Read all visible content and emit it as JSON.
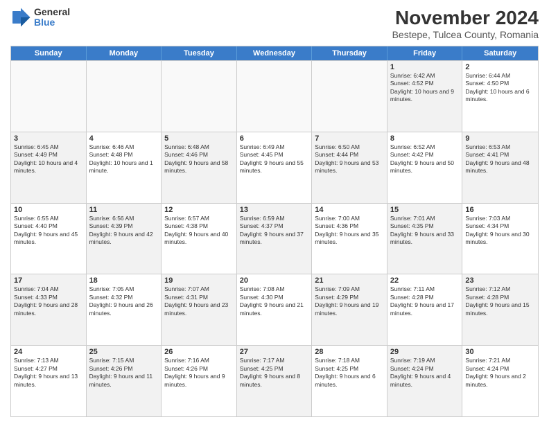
{
  "logo": {
    "general": "General",
    "blue": "Blue"
  },
  "title": "November 2024",
  "location": "Bestepe, Tulcea County, Romania",
  "headers": [
    "Sunday",
    "Monday",
    "Tuesday",
    "Wednesday",
    "Thursday",
    "Friday",
    "Saturday"
  ],
  "rows": [
    [
      {
        "day": "",
        "info": ""
      },
      {
        "day": "",
        "info": ""
      },
      {
        "day": "",
        "info": ""
      },
      {
        "day": "",
        "info": ""
      },
      {
        "day": "",
        "info": ""
      },
      {
        "day": "1",
        "info": "Sunrise: 6:42 AM\nSunset: 4:52 PM\nDaylight: 10 hours and 9 minutes."
      },
      {
        "day": "2",
        "info": "Sunrise: 6:44 AM\nSunset: 4:50 PM\nDaylight: 10 hours and 6 minutes."
      }
    ],
    [
      {
        "day": "3",
        "info": "Sunrise: 6:45 AM\nSunset: 4:49 PM\nDaylight: 10 hours and 4 minutes."
      },
      {
        "day": "4",
        "info": "Sunrise: 6:46 AM\nSunset: 4:48 PM\nDaylight: 10 hours and 1 minute."
      },
      {
        "day": "5",
        "info": "Sunrise: 6:48 AM\nSunset: 4:46 PM\nDaylight: 9 hours and 58 minutes."
      },
      {
        "day": "6",
        "info": "Sunrise: 6:49 AM\nSunset: 4:45 PM\nDaylight: 9 hours and 55 minutes."
      },
      {
        "day": "7",
        "info": "Sunrise: 6:50 AM\nSunset: 4:44 PM\nDaylight: 9 hours and 53 minutes."
      },
      {
        "day": "8",
        "info": "Sunrise: 6:52 AM\nSunset: 4:42 PM\nDaylight: 9 hours and 50 minutes."
      },
      {
        "day": "9",
        "info": "Sunrise: 6:53 AM\nSunset: 4:41 PM\nDaylight: 9 hours and 48 minutes."
      }
    ],
    [
      {
        "day": "10",
        "info": "Sunrise: 6:55 AM\nSunset: 4:40 PM\nDaylight: 9 hours and 45 minutes."
      },
      {
        "day": "11",
        "info": "Sunrise: 6:56 AM\nSunset: 4:39 PM\nDaylight: 9 hours and 42 minutes."
      },
      {
        "day": "12",
        "info": "Sunrise: 6:57 AM\nSunset: 4:38 PM\nDaylight: 9 hours and 40 minutes."
      },
      {
        "day": "13",
        "info": "Sunrise: 6:59 AM\nSunset: 4:37 PM\nDaylight: 9 hours and 37 minutes."
      },
      {
        "day": "14",
        "info": "Sunrise: 7:00 AM\nSunset: 4:36 PM\nDaylight: 9 hours and 35 minutes."
      },
      {
        "day": "15",
        "info": "Sunrise: 7:01 AM\nSunset: 4:35 PM\nDaylight: 9 hours and 33 minutes."
      },
      {
        "day": "16",
        "info": "Sunrise: 7:03 AM\nSunset: 4:34 PM\nDaylight: 9 hours and 30 minutes."
      }
    ],
    [
      {
        "day": "17",
        "info": "Sunrise: 7:04 AM\nSunset: 4:33 PM\nDaylight: 9 hours and 28 minutes."
      },
      {
        "day": "18",
        "info": "Sunrise: 7:05 AM\nSunset: 4:32 PM\nDaylight: 9 hours and 26 minutes."
      },
      {
        "day": "19",
        "info": "Sunrise: 7:07 AM\nSunset: 4:31 PM\nDaylight: 9 hours and 23 minutes."
      },
      {
        "day": "20",
        "info": "Sunrise: 7:08 AM\nSunset: 4:30 PM\nDaylight: 9 hours and 21 minutes."
      },
      {
        "day": "21",
        "info": "Sunrise: 7:09 AM\nSunset: 4:29 PM\nDaylight: 9 hours and 19 minutes."
      },
      {
        "day": "22",
        "info": "Sunrise: 7:11 AM\nSunset: 4:28 PM\nDaylight: 9 hours and 17 minutes."
      },
      {
        "day": "23",
        "info": "Sunrise: 7:12 AM\nSunset: 4:28 PM\nDaylight: 9 hours and 15 minutes."
      }
    ],
    [
      {
        "day": "24",
        "info": "Sunrise: 7:13 AM\nSunset: 4:27 PM\nDaylight: 9 hours and 13 minutes."
      },
      {
        "day": "25",
        "info": "Sunrise: 7:15 AM\nSunset: 4:26 PM\nDaylight: 9 hours and 11 minutes."
      },
      {
        "day": "26",
        "info": "Sunrise: 7:16 AM\nSunset: 4:26 PM\nDaylight: 9 hours and 9 minutes."
      },
      {
        "day": "27",
        "info": "Sunrise: 7:17 AM\nSunset: 4:25 PM\nDaylight: 9 hours and 8 minutes."
      },
      {
        "day": "28",
        "info": "Sunrise: 7:18 AM\nSunset: 4:25 PM\nDaylight: 9 hours and 6 minutes."
      },
      {
        "day": "29",
        "info": "Sunrise: 7:19 AM\nSunset: 4:24 PM\nDaylight: 9 hours and 4 minutes."
      },
      {
        "day": "30",
        "info": "Sunrise: 7:21 AM\nSunset: 4:24 PM\nDaylight: 9 hours and 2 minutes."
      }
    ]
  ]
}
